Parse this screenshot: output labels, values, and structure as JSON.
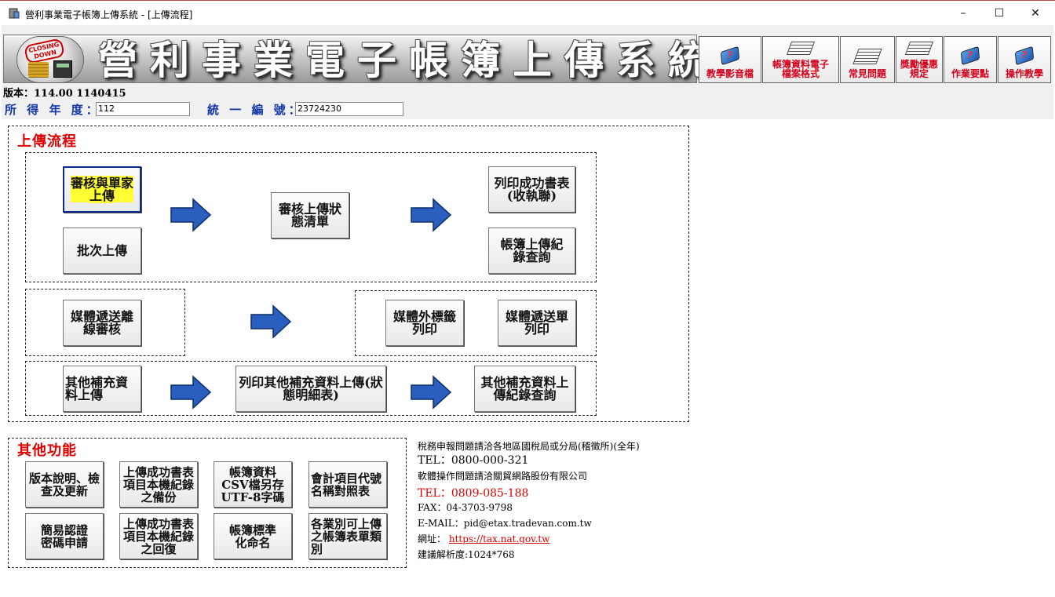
{
  "window": {
    "title": "營利事業電子帳簿上傳系統 - [上傳流程]",
    "minimize": "–",
    "maximize": "☐",
    "close": "✕"
  },
  "banner": {
    "logo_stamp": "CLOSING DOWN",
    "title": "營利事業電子帳簿上傳系統"
  },
  "top_buttons": [
    {
      "label": "教學影音檔",
      "icon": "book-question-icon"
    },
    {
      "label": "帳簿資料電子檔案格式",
      "icon": "paper-stack-icon"
    },
    {
      "label": "常見問題",
      "icon": "paper-stack-icon"
    },
    {
      "label": "獎勵優惠規定",
      "icon": "paper-stack-icon"
    },
    {
      "label": "作業要點",
      "icon": "book-question-icon"
    },
    {
      "label": "操作教學",
      "icon": "book-question-icon"
    }
  ],
  "version": "版本：114.00 1140415",
  "fields": {
    "year_label": "所 得 年 度：",
    "year_value": "112",
    "id_label": "統 一 編 號：",
    "id_value": "23724230"
  },
  "upload_flow": {
    "title": "上傳流程",
    "review_upload": "審核與單家上傳",
    "review_upload_line1": "審核與單家",
    "review_upload_line2": "上傳",
    "batch_upload": "批次上傳",
    "review_status": "審核上傳狀態清單",
    "print_receipt": "列印成功書表(收執聯)",
    "upload_log": "帳簿上傳紀錄查詢",
    "media_offline": "媒體遞送離線審核",
    "media_label": "媒體外標籤列印",
    "media_sheet": "媒體遞送單列印",
    "other_upload": "其他補充資料上傳",
    "print_other": "列印其他補充資料上傳(狀態明細表)",
    "other_log": "其他補充資料上傳紀錄查詢"
  },
  "other_functions": {
    "title": "其他功能",
    "buttons": [
      "版本說明、檢查及更新",
      "上傳成功書表項目本機紀錄之備份",
      "帳簿資料CSV檔另存UTF-8字碼",
      "會計項目代號名稱對照表",
      "簡易認證密碼申請",
      "上傳成功書表項目本機紀錄之回復",
      "帳簿標準化命名",
      "各業別可上傳之帳簿表單類別"
    ]
  },
  "contact": {
    "tax_line": "稅務申報問題請洽各地區國稅局或分局(稽徵所)(全年)",
    "tax_tel": "TEL：0800-000-321",
    "software_line": "軟體操作問題請洽關貿網路股份有限公司",
    "software_tel": "TEL：0809-085-188",
    "fax": "FAX：04-3703-9798",
    "email": "E-MAIL：pid@etax.tradevan.com.tw",
    "url_label": "網址：",
    "url": "https://tax.nat.gov.tw",
    "resolution": "建議解析度:1024*768"
  },
  "colors": {
    "accent_red": "#d00000",
    "label_blue": "#1438a8",
    "arrow_blue": "#2a5fc0",
    "highlight": "#ffff33"
  }
}
